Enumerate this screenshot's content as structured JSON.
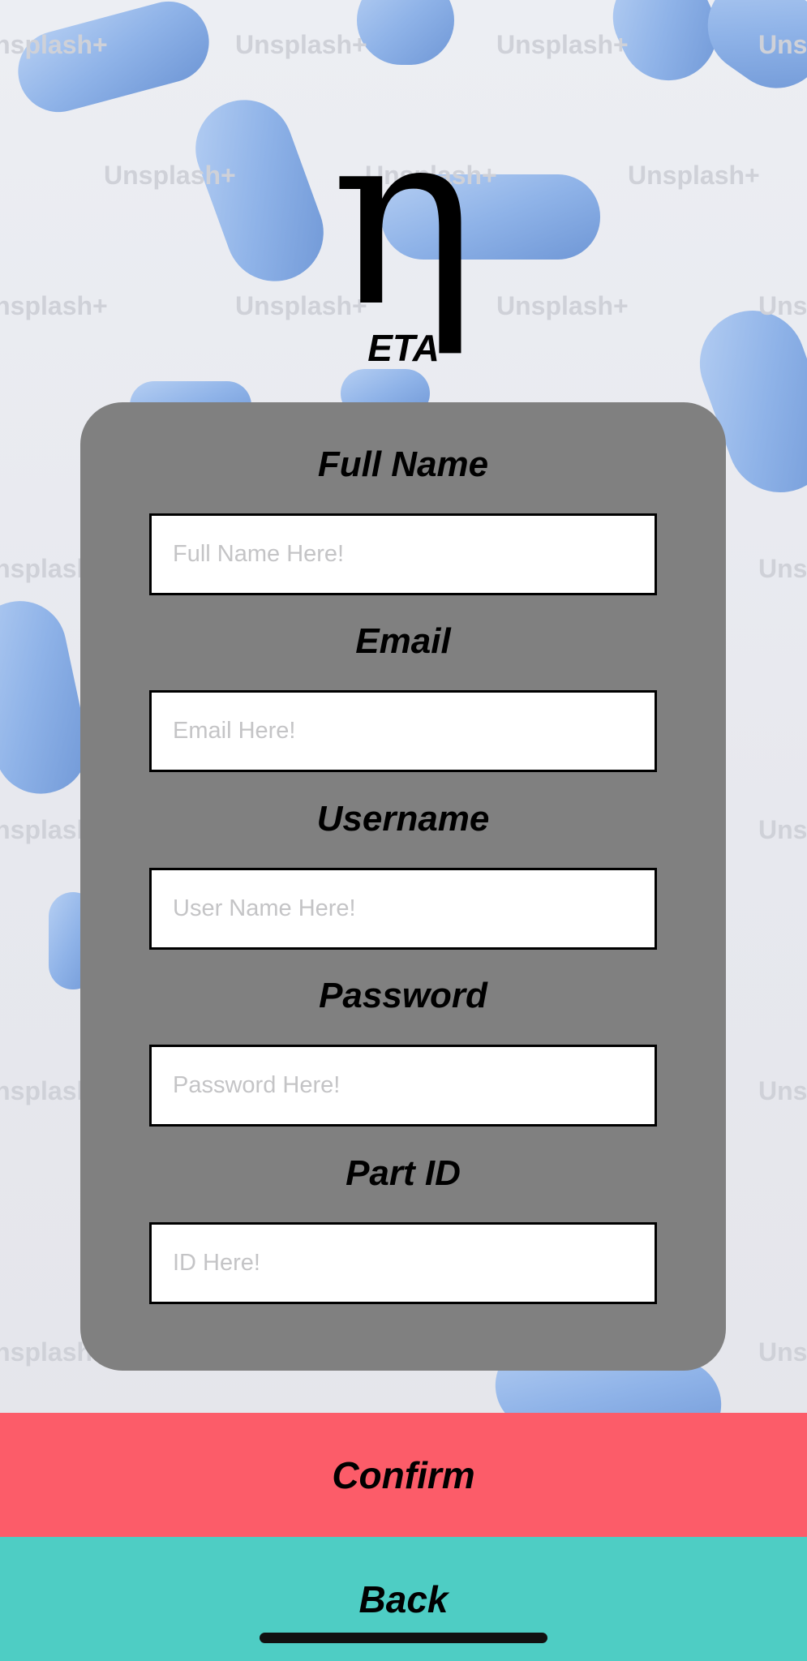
{
  "background": {
    "watermark_text": "Unsplash+",
    "pill_color": "#8fb3e8"
  },
  "logo": {
    "glyph": "η",
    "name": "ETA"
  },
  "form": {
    "fields": [
      {
        "label": "Full Name",
        "placeholder": "Full Name Here!",
        "value": ""
      },
      {
        "label": "Email",
        "placeholder": "Email Here!",
        "value": ""
      },
      {
        "label": "Username",
        "placeholder": "User Name Here!",
        "value": ""
      },
      {
        "label": "Password",
        "placeholder": "Password Here!",
        "value": ""
      },
      {
        "label": "Part ID",
        "placeholder": "ID Here!",
        "value": ""
      }
    ]
  },
  "actions": {
    "confirm_label": "Confirm",
    "confirm_color": "#fc5c69",
    "back_label": "Back",
    "back_color": "#4ecdc4"
  },
  "colors": {
    "card": "#808080"
  }
}
